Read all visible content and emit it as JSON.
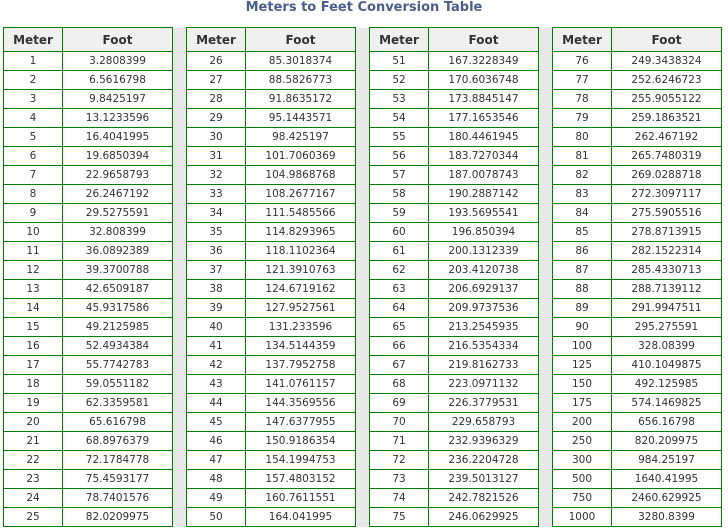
{
  "title": "Meters to Feet Conversion Table",
  "headers": {
    "meter": "Meter",
    "foot": "Foot"
  },
  "columns": [
    {
      "rows": [
        {
          "m": "1",
          "f": "3.2808399"
        },
        {
          "m": "2",
          "f": "6.5616798"
        },
        {
          "m": "3",
          "f": "9.8425197"
        },
        {
          "m": "4",
          "f": "13.1233596"
        },
        {
          "m": "5",
          "f": "16.4041995"
        },
        {
          "m": "6",
          "f": "19.6850394"
        },
        {
          "m": "7",
          "f": "22.9658793"
        },
        {
          "m": "8",
          "f": "26.2467192"
        },
        {
          "m": "9",
          "f": "29.5275591"
        },
        {
          "m": "10",
          "f": "32.808399"
        },
        {
          "m": "11",
          "f": "36.0892389"
        },
        {
          "m": "12",
          "f": "39.3700788"
        },
        {
          "m": "13",
          "f": "42.6509187"
        },
        {
          "m": "14",
          "f": "45.9317586"
        },
        {
          "m": "15",
          "f": "49.2125985"
        },
        {
          "m": "16",
          "f": "52.4934384"
        },
        {
          "m": "17",
          "f": "55.7742783"
        },
        {
          "m": "18",
          "f": "59.0551182"
        },
        {
          "m": "19",
          "f": "62.3359581"
        },
        {
          "m": "20",
          "f": "65.616798"
        },
        {
          "m": "21",
          "f": "68.8976379"
        },
        {
          "m": "22",
          "f": "72.1784778"
        },
        {
          "m": "23",
          "f": "75.4593177"
        },
        {
          "m": "24",
          "f": "78.7401576"
        },
        {
          "m": "25",
          "f": "82.0209975"
        }
      ]
    },
    {
      "rows": [
        {
          "m": "26",
          "f": "85.3018374"
        },
        {
          "m": "27",
          "f": "88.5826773"
        },
        {
          "m": "28",
          "f": "91.8635172"
        },
        {
          "m": "29",
          "f": "95.1443571"
        },
        {
          "m": "30",
          "f": "98.425197"
        },
        {
          "m": "31",
          "f": "101.7060369"
        },
        {
          "m": "32",
          "f": "104.9868768"
        },
        {
          "m": "33",
          "f": "108.2677167"
        },
        {
          "m": "34",
          "f": "111.5485566"
        },
        {
          "m": "35",
          "f": "114.8293965"
        },
        {
          "m": "36",
          "f": "118.1102364"
        },
        {
          "m": "37",
          "f": "121.3910763"
        },
        {
          "m": "38",
          "f": "124.6719162"
        },
        {
          "m": "39",
          "f": "127.9527561"
        },
        {
          "m": "40",
          "f": "131.233596"
        },
        {
          "m": "41",
          "f": "134.5144359"
        },
        {
          "m": "42",
          "f": "137.7952758"
        },
        {
          "m": "43",
          "f": "141.0761157"
        },
        {
          "m": "44",
          "f": "144.3569556"
        },
        {
          "m": "45",
          "f": "147.6377955"
        },
        {
          "m": "46",
          "f": "150.9186354"
        },
        {
          "m": "47",
          "f": "154.1994753"
        },
        {
          "m": "48",
          "f": "157.4803152"
        },
        {
          "m": "49",
          "f": "160.7611551"
        },
        {
          "m": "50",
          "f": "164.041995"
        }
      ]
    },
    {
      "rows": [
        {
          "m": "51",
          "f": "167.3228349"
        },
        {
          "m": "52",
          "f": "170.6036748"
        },
        {
          "m": "53",
          "f": "173.8845147"
        },
        {
          "m": "54",
          "f": "177.1653546"
        },
        {
          "m": "55",
          "f": "180.4461945"
        },
        {
          "m": "56",
          "f": "183.7270344"
        },
        {
          "m": "57",
          "f": "187.0078743"
        },
        {
          "m": "58",
          "f": "190.2887142"
        },
        {
          "m": "59",
          "f": "193.5695541"
        },
        {
          "m": "60",
          "f": "196.850394"
        },
        {
          "m": "61",
          "f": "200.1312339"
        },
        {
          "m": "62",
          "f": "203.4120738"
        },
        {
          "m": "63",
          "f": "206.6929137"
        },
        {
          "m": "64",
          "f": "209.9737536"
        },
        {
          "m": "65",
          "f": "213.2545935"
        },
        {
          "m": "66",
          "f": "216.5354334"
        },
        {
          "m": "67",
          "f": "219.8162733"
        },
        {
          "m": "68",
          "f": "223.0971132"
        },
        {
          "m": "69",
          "f": "226.3779531"
        },
        {
          "m": "70",
          "f": "229.658793"
        },
        {
          "m": "71",
          "f": "232.9396329"
        },
        {
          "m": "72",
          "f": "236.2204728"
        },
        {
          "m": "73",
          "f": "239.5013127"
        },
        {
          "m": "74",
          "f": "242.7821526"
        },
        {
          "m": "75",
          "f": "246.0629925"
        }
      ]
    },
    {
      "rows": [
        {
          "m": "76",
          "f": "249.3438324"
        },
        {
          "m": "77",
          "f": "252.6246723"
        },
        {
          "m": "78",
          "f": "255.9055122"
        },
        {
          "m": "79",
          "f": "259.1863521"
        },
        {
          "m": "80",
          "f": "262.467192"
        },
        {
          "m": "81",
          "f": "265.7480319"
        },
        {
          "m": "82",
          "f": "269.0288718"
        },
        {
          "m": "83",
          "f": "272.3097117"
        },
        {
          "m": "84",
          "f": "275.5905516"
        },
        {
          "m": "85",
          "f": "278.8713915"
        },
        {
          "m": "86",
          "f": "282.1522314"
        },
        {
          "m": "87",
          "f": "285.4330713"
        },
        {
          "m": "88",
          "f": "288.7139112"
        },
        {
          "m": "89",
          "f": "291.9947511"
        },
        {
          "m": "90",
          "f": "295.275591"
        },
        {
          "m": "100",
          "f": "328.08399"
        },
        {
          "m": "125",
          "f": "410.1049875"
        },
        {
          "m": "150",
          "f": "492.125985"
        },
        {
          "m": "175",
          "f": "574.1469825"
        },
        {
          "m": "200",
          "f": "656.16798"
        },
        {
          "m": "250",
          "f": "820.209975"
        },
        {
          "m": "300",
          "f": "984.25197"
        },
        {
          "m": "500",
          "f": "1640.41995"
        },
        {
          "m": "750",
          "f": "2460.629925"
        },
        {
          "m": "1000",
          "f": "3280.8399"
        }
      ]
    }
  ]
}
